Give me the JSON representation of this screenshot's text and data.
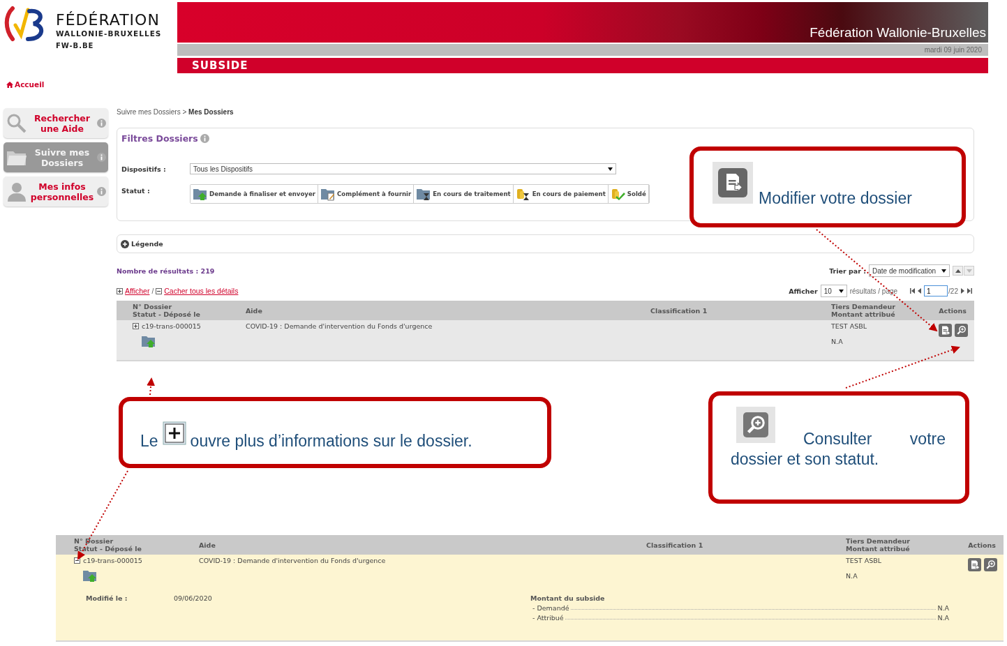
{
  "logo": {
    "title": "FÉDÉRATION",
    "subtitle": "WALLONIE-BRUXELLES",
    "url": "FW-B.BE"
  },
  "banner": {
    "title": "Fédération Wallonie-Bruxelles",
    "date": "mardi 09 juin 2020",
    "section": "SUBSIDE"
  },
  "home_link": "Accueil",
  "sidebar": {
    "items": [
      {
        "label": "Rechercher une Aide",
        "kind": "search",
        "selected": false
      },
      {
        "label": "Suivre mes Dossiers",
        "kind": "folder",
        "selected": true
      },
      {
        "label": "Mes infos personnelles",
        "kind": "person",
        "selected": false
      }
    ]
  },
  "breadcrumb": {
    "parent": "Suivre mes Dossiers",
    "separator": ">",
    "current": "Mes Dossiers"
  },
  "filters": {
    "title": "Filtres Dossiers",
    "dispositifs_label": "Dispositifs :",
    "dispositifs_value": "Tous les Dispositifs",
    "statut_label": "Statut :",
    "statuses": [
      {
        "label": "Demande à finaliser et envoyer",
        "kind": "upload"
      },
      {
        "label": "Complément à fournir",
        "kind": "edit"
      },
      {
        "label": "En cours de traitement",
        "kind": "hourglass"
      },
      {
        "label": "En cours de paiement",
        "kind": "coins-hourglass"
      },
      {
        "label": "Soldé",
        "kind": "coins-check"
      }
    ]
  },
  "legend": {
    "label": "Légende"
  },
  "results": {
    "count_label": "Nombre de résultats : 219",
    "sort_label": "Trier par :",
    "sort_value": "Date de modification",
    "show_all": "Afficher",
    "separator": "/",
    "hide_all": "Cacher tous les détails",
    "per_page_label": "Afficher",
    "per_page_value": "10",
    "per_page_suffix": "résultats / page",
    "page_value": "1",
    "page_total": "/22"
  },
  "tables": [
    {
      "expanded": false,
      "columns": [
        {
          "line1": "N° Dossier",
          "line2": "Statut - Déposé le"
        },
        {
          "line1": "Aide"
        },
        {
          "line1": "Classification 1"
        },
        {
          "line1": "Tiers Demandeur",
          "line2": "Montant attribué"
        },
        {
          "line1": "Actions"
        }
      ],
      "row": {
        "number": "c19-trans-000015",
        "aide": "COVID-19 : Demande d'intervention du Fonds d'urgence",
        "tiers": "TEST ASBL",
        "montant": "N.A"
      }
    },
    {
      "expanded": true,
      "columns": [
        {
          "line1": "N° Dossier",
          "line2": "Statut - Déposé le"
        },
        {
          "line1": "Aide"
        },
        {
          "line1": "Classification 1"
        },
        {
          "line1": "Tiers Demandeur",
          "line2": "Montant attribué"
        },
        {
          "line1": "Actions"
        }
      ],
      "row": {
        "number": "c19-trans-000015",
        "aide": "COVID-19 : Demande d'intervention du Fonds d'urgence",
        "tiers": "TEST ASBL",
        "montant": "N.A"
      },
      "details": {
        "modified_label": "Modifié le :",
        "modified_value": "09/06/2020",
        "amount_title": "Montant du subside",
        "amount_lines": [
          {
            "label": "- Demandé",
            "value": "N.A"
          },
          {
            "label": "- Attribué",
            "value": "N.A"
          }
        ]
      }
    }
  ],
  "callouts": [
    {
      "kind": "edit",
      "text": "Modifier votre dossier"
    },
    {
      "kind": "expand",
      "before": "Le",
      "text": "ouvre plus d’informations sur le dossier."
    },
    {
      "kind": "view",
      "lines": [
        "Consulter votre",
        "dossier et son statut."
      ]
    }
  ]
}
